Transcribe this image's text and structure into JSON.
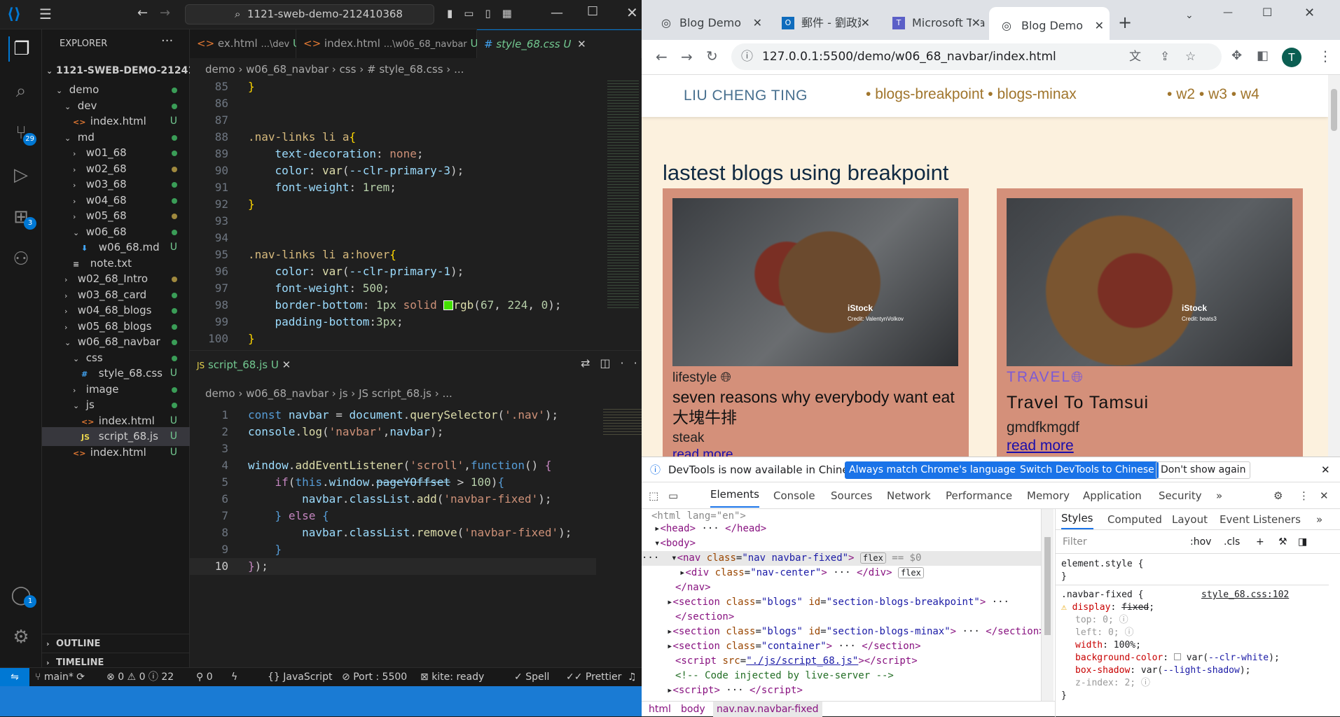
{
  "vscode": {
    "search": "1121-sweb-demo-212410368",
    "explorer_title": "EXPLORER",
    "root": "1121-SWEB-DEMO-21241...",
    "tree": [
      {
        "label": "demo",
        "depth": 1,
        "open": true,
        "folder": true
      },
      {
        "label": "dev",
        "depth": 2,
        "open": true,
        "folder": true
      },
      {
        "label": "index.html",
        "depth": 3,
        "icon": "html",
        "status": "U"
      },
      {
        "label": "md",
        "depth": 2,
        "open": true,
        "folder": true
      },
      {
        "label": "w01_68",
        "depth": 3,
        "folder": true
      },
      {
        "label": "w02_68",
        "depth": 3,
        "folder": true,
        "dot": "#a0893e"
      },
      {
        "label": "w03_68",
        "depth": 3,
        "folder": true
      },
      {
        "label": "w04_68",
        "depth": 3,
        "folder": true
      },
      {
        "label": "w05_68",
        "depth": 3,
        "folder": true,
        "dot": "#a0893e"
      },
      {
        "label": "w06_68",
        "depth": 3,
        "open": true,
        "folder": true
      },
      {
        "label": "w06_68.md",
        "depth": 4,
        "icon": "md",
        "status": "U"
      },
      {
        "label": "note.txt",
        "depth": 3,
        "icon": "txt"
      },
      {
        "label": "w02_68_Intro",
        "depth": 2,
        "folder": true,
        "dot": "#a0893e"
      },
      {
        "label": "w03_68_card",
        "depth": 2,
        "folder": true
      },
      {
        "label": "w04_68_blogs",
        "depth": 2,
        "folder": true
      },
      {
        "label": "w05_68_blogs",
        "depth": 2,
        "folder": true
      },
      {
        "label": "w06_68_navbar",
        "depth": 2,
        "open": true,
        "folder": true
      },
      {
        "label": "css",
        "depth": 3,
        "open": true,
        "folder": true
      },
      {
        "label": "style_68.css",
        "depth": 4,
        "icon": "css",
        "status": "U"
      },
      {
        "label": "image",
        "depth": 3,
        "folder": true
      },
      {
        "label": "js",
        "depth": 3,
        "open": true,
        "folder": true
      },
      {
        "label": "index.html",
        "depth": 4,
        "icon": "html",
        "status": "U"
      },
      {
        "label": "script_68.js",
        "depth": 4,
        "icon": "js",
        "status": "U",
        "selected": true
      },
      {
        "label": "index.html",
        "depth": 3,
        "icon": "html",
        "status": "U"
      }
    ],
    "outline": "OUTLINE",
    "timeline": "TIMELINE",
    "badges": {
      "scm": "29",
      "ext": "3",
      "account": "1"
    },
    "tabs": [
      {
        "label": "ex.html",
        "desc": "...\\dev",
        "status": "U"
      },
      {
        "label": "index.html",
        "desc": "...\\w06_68_navbar",
        "status": "U"
      },
      {
        "label": "style_68.css",
        "desc": "",
        "status": "U"
      }
    ],
    "css_crumb": [
      "demo",
      "w06_68_navbar",
      "css",
      "# style_68.css",
      "..."
    ],
    "js_tab": "script_68.js",
    "js_tab_status": "U",
    "js_crumb": [
      "demo",
      "w06_68_navbar",
      "js",
      "JS script_68.js",
      "..."
    ],
    "status": {
      "branch": "main*",
      "errors": "0",
      "warnings": "0",
      "info": "22",
      "ports": "0",
      "lang": "JavaScript",
      "port": "Port : 5500",
      "kite": "kite: ready",
      "spell": "Spell",
      "prettier": "Prettier"
    }
  },
  "chrome": {
    "tabs": [
      "Blog Demo",
      "郵件 - 劉政廷",
      "Microsoft Teams",
      "Blog Demo"
    ],
    "url": "127.0.0.1:5500/demo/w06_68_navbar/index.html",
    "profile": "T",
    "page": {
      "brand": "LIU CHENG TING",
      "links_mid": [
        "blogs-breakpoint",
        "blogs-minax"
      ],
      "links_right": [
        "w2",
        "w3",
        "w4"
      ],
      "heading": "lastest blogs using breakpoint",
      "cards": [
        {
          "category": "lifestyle",
          "title": "seven reasons why everybody want eat 大塊牛排",
          "desc": "steak",
          "link": "read more",
          "credit": "Credit: ValentynVolkov"
        },
        {
          "category": "TRAVEL",
          "title": "Travel To Tamsui",
          "desc": "gmdfkmgdf",
          "link": "read more",
          "credit": "Credit: beats3"
        }
      ]
    },
    "devtools": {
      "notice": "DevTools is now available in Chinese!",
      "btn1": "Always match Chrome's language",
      "btn2": "Switch DevTools to Chinese",
      "btn3": "Don't show again",
      "tabs": [
        "Elements",
        "Console",
        "Sources",
        "Network",
        "Performance",
        "Memory",
        "Application",
        "Security"
      ],
      "side_tabs": [
        "Styles",
        "Computed",
        "Layout",
        "Event Listeners"
      ],
      "filter": "Filter",
      "hov": ":hov",
      "cls": ".cls",
      "breadcrumbs": [
        "html",
        "body",
        "nav.nav.navbar-fixed"
      ],
      "rule_source": "style_68.css:102"
    }
  }
}
